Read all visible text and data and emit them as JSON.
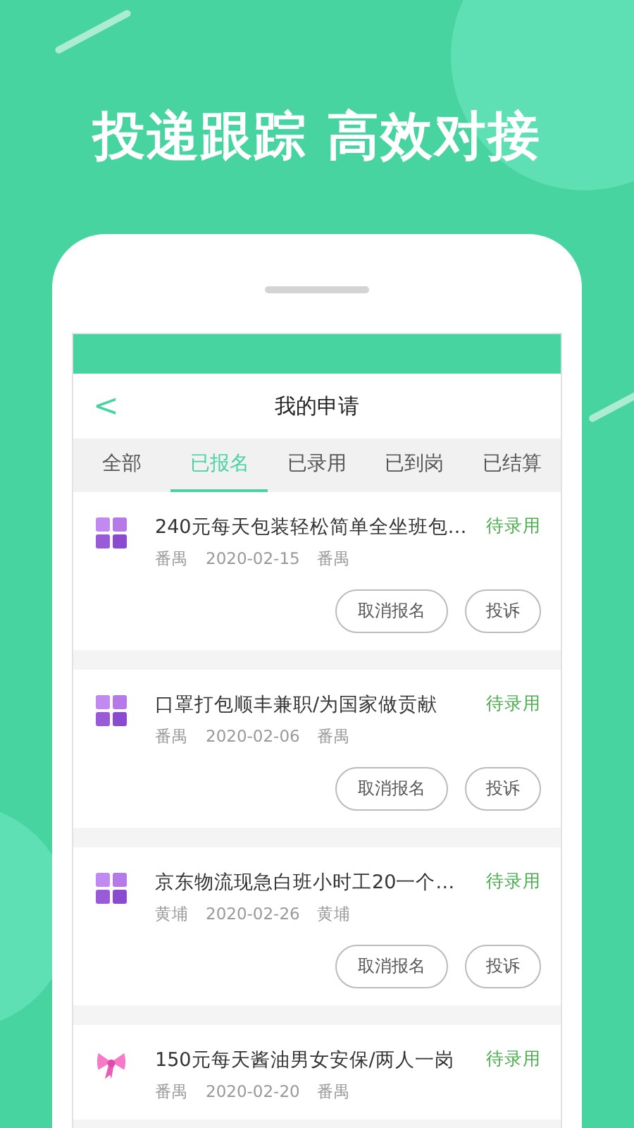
{
  "headline": "投递跟踪 高效对接",
  "nav": {
    "back": "<",
    "title": "我的申请"
  },
  "tabs": [
    {
      "label": "全部",
      "selected": false
    },
    {
      "label": "已报名",
      "selected": true
    },
    {
      "label": "已录用",
      "selected": false
    },
    {
      "label": "已到岗",
      "selected": false
    },
    {
      "label": "已结算",
      "selected": false
    }
  ],
  "applications": [
    {
      "kind": "grid",
      "title": "240元每天包装轻松简单全坐班包…",
      "status": "待录用",
      "district": "番禺",
      "date": "2020-02-15",
      "area": "番禺",
      "buttons": [
        "取消报名",
        "投诉"
      ]
    },
    {
      "kind": "grid",
      "title": "口罩打包顺丰兼职/为国家做贡献",
      "status": "待录用",
      "district": "番禺",
      "date": "2020-02-06",
      "area": "番禺",
      "buttons": [
        "取消报名",
        "投诉"
      ]
    },
    {
      "kind": "grid",
      "title": "京东物流现急白班小时工20一个…",
      "status": "待录用",
      "district": "黄埔",
      "date": "2020-02-26",
      "area": "黄埔",
      "buttons": [
        "取消报名",
        "投诉"
      ]
    },
    {
      "kind": "bow",
      "title": "150元每天酱油男女安保/两人一岗",
      "status": "待录用",
      "district": "番禺",
      "date": "2020-02-20",
      "area": "番禺"
    }
  ]
}
